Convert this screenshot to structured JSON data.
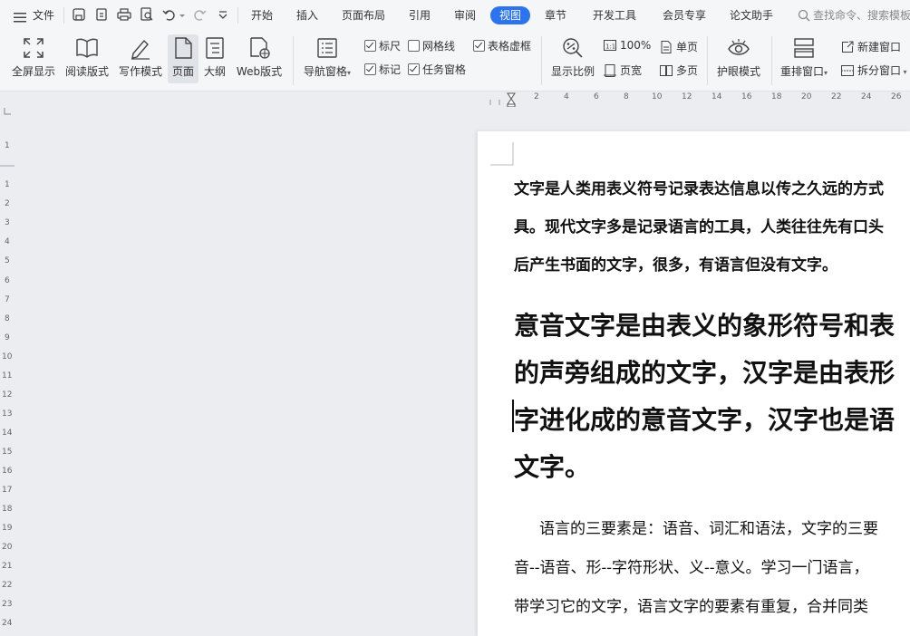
{
  "menu": {
    "file_label": "文件",
    "tabs": [
      "开始",
      "插入",
      "页面布局",
      "引用",
      "审阅",
      "视图",
      "章节",
      "开发工具",
      "会员专享",
      "论文助手"
    ],
    "active_tab": "视图",
    "search_placeholder": "查找命令、搜索模板"
  },
  "ribbon": {
    "view_buttons": [
      "全屏显示",
      "阅读版式",
      "写作模式",
      "页面",
      "大纲",
      "Web版式"
    ],
    "nav_pane": "导航窗格",
    "checks": [
      {
        "label": "标尺",
        "checked": true
      },
      {
        "label": "网格线",
        "checked": false
      },
      {
        "label": "表格虚框",
        "checked": true
      },
      {
        "label": "标记",
        "checked": true
      },
      {
        "label": "任务窗格",
        "checked": true
      }
    ],
    "zoom": "显示比例",
    "zoom_100": "100%",
    "single_page": "单页",
    "page_width": "页宽",
    "multi_page": "多页",
    "eye_mode": "护眼模式",
    "rearrange": "重排窗口",
    "new_window": "新建窗口",
    "split_window": "拆分窗口"
  },
  "ruler": {
    "h_numbers": [
      "2",
      "4",
      "6",
      "8",
      "10",
      "12",
      "14",
      "16",
      "18",
      "20",
      "22",
      "24",
      "26"
    ],
    "v_numbers": [
      "1",
      "1",
      "2",
      "3",
      "4",
      "5",
      "6",
      "7",
      "8",
      "9",
      "10",
      "11",
      "12",
      "13",
      "14",
      "15",
      "16",
      "17",
      "18",
      "19",
      "20",
      "21",
      "22",
      "23",
      "24"
    ]
  },
  "document": {
    "para1": [
      "文字是人类用表义符号记录表达信息以传之久远的方式",
      "具。现代文字多是记录语言的工具，人类往往先有口头",
      "后产生书面的文字，很多，有语言但没有文字。"
    ],
    "heading": [
      "意音文字是由表义的象形符号和表",
      "的声旁组成的文字，汉字是由表形",
      "字进化成的意音文字，汉字也是语",
      "文字。"
    ],
    "para3": [
      "语言的三要素是：语音、词汇和语法，文字的三要",
      "音--语音、形--字符形状、义--意义。学习一门语言，",
      "带学习它的文字，语言文字的要素有重复，合并同类"
    ]
  }
}
